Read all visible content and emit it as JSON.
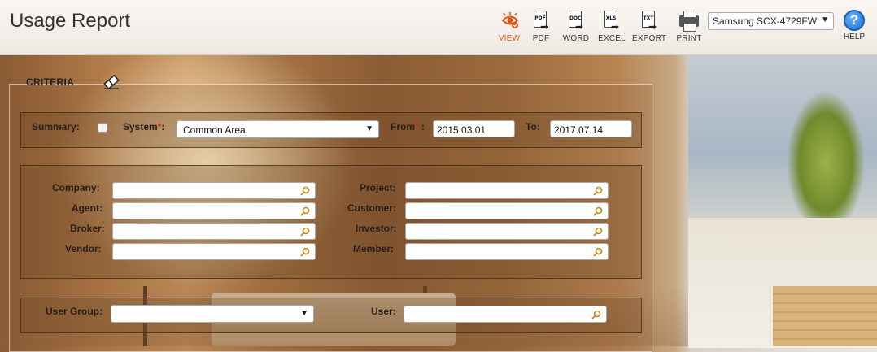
{
  "header": {
    "title": "Usage Report",
    "accent_color": "#e0561b",
    "toolbar": [
      {
        "id": "view",
        "label": "VIEW",
        "icon": "view-eye-icon",
        "active": true
      },
      {
        "id": "pdf",
        "label": "PDF",
        "icon": "pdf-icon",
        "doc_text": "PDF"
      },
      {
        "id": "word",
        "label": "WORD",
        "icon": "word-icon",
        "doc_text": "DOC"
      },
      {
        "id": "excel",
        "label": "EXCEL",
        "icon": "excel-icon",
        "doc_text": "XLS"
      },
      {
        "id": "export",
        "label": "EXPORT",
        "icon": "export-icon",
        "doc_text": "TXT"
      },
      {
        "id": "print",
        "label": "PRINT",
        "icon": "printer-icon"
      }
    ],
    "printer_selected": "Samsung SCX-4729FW",
    "help_label": "HELP",
    "help_glyph": "?"
  },
  "criteria": {
    "legend": "CRITERIA",
    "summary_label": "Summary:",
    "summary_checked": false,
    "system_label": "System",
    "required_mark": "*",
    "system_value": "Common Area",
    "from_label": "From",
    "from_value": "2015.03.01",
    "to_label": "To:",
    "to_value": "2017.07.14",
    "left_fields": [
      {
        "label": "Company:",
        "value": ""
      },
      {
        "label": "Agent:",
        "value": ""
      },
      {
        "label": "Broker:",
        "value": ""
      },
      {
        "label": "Vendor:",
        "value": ""
      }
    ],
    "right_fields": [
      {
        "label": "Project:",
        "value": ""
      },
      {
        "label": "Customer:",
        "value": ""
      },
      {
        "label": "Investor:",
        "value": ""
      },
      {
        "label": "Member:",
        "value": ""
      }
    ],
    "user_group_label": "User Group:",
    "user_group_value": "",
    "user_label": "User:",
    "user_value": ""
  }
}
